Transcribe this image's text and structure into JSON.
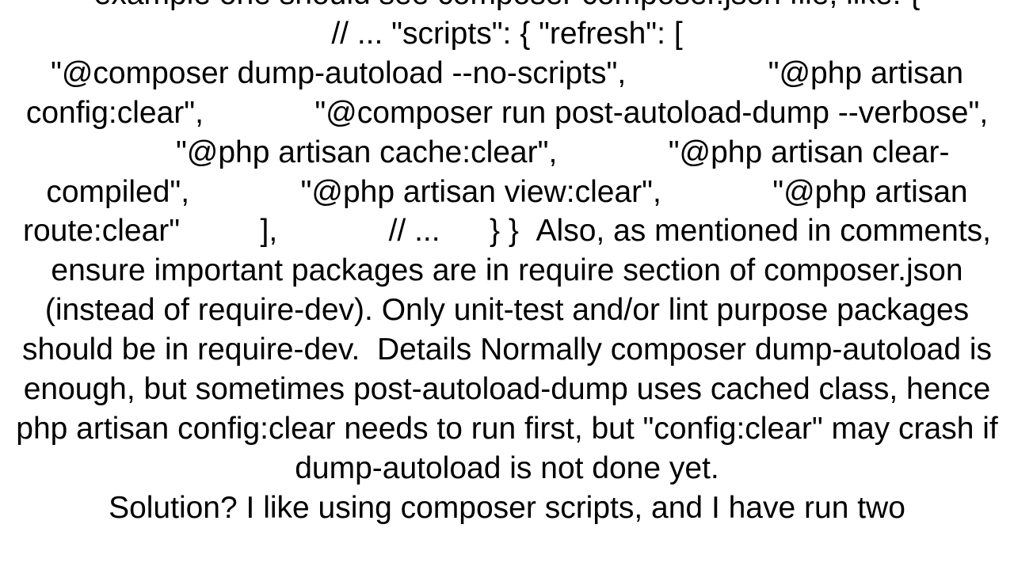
{
  "doc": {
    "line_top_partial": "example one should see composer composer.json file, like: {",
    "scripts_line": "// ...       \"scripts\": {         \"refresh\": [",
    "cmd1": "\"@composer dump-autoload --no-scripts\",",
    "cmd2": "\"@php artisan config:clear\",",
    "cmd3": "\"@composer run post-autoload-dump --verbose\",",
    "cmd4": "\"@php artisan cache:clear\",",
    "cmd5": "\"@php artisan clear-compiled\",",
    "cmd6": "\"@php artisan view:clear\",",
    "cmd7": "\"@php artisan route:clear\"",
    "close_array": "],",
    "close_comment": "// ...",
    "close_braces": "} }",
    "also_prefix": "Also, as",
    "para_also_rest": "mentioned in comments, ensure important packages are in require section of composer.json (instead of require-dev). Only unit-test and/or lint purpose packages should be in require-dev.",
    "details_heading": "Details",
    "details_body": "Normally composer dump-autoload is enough, but sometimes post-autoload-dump uses cached class, hence php artisan config:clear needs to run first, but \"config:clear\" may crash if dump-autoload is not done yet.",
    "bottom_partial": "Solution? I like using composer scripts, and I have run two"
  }
}
